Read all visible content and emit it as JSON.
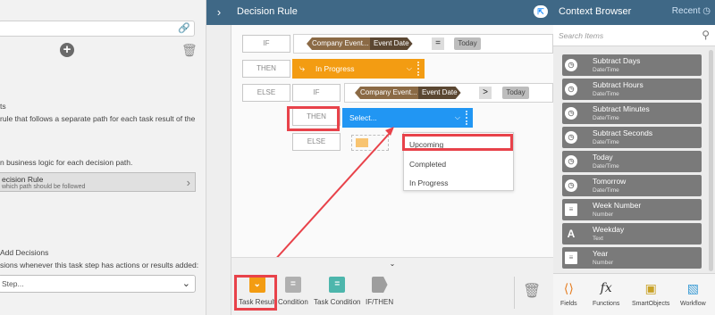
{
  "left_panel": {
    "line_ts": "ts",
    "line_rule": "rule that follows a separate path for each task result of the",
    "line_logic": "n business logic for each decision path.",
    "selected_title": "ecision Rule",
    "selected_sub": "which path should be followed",
    "add_decisions": "Add Decisions",
    "actions_text": "sions whenever this task step has actions or results added:",
    "select_placeholder": "Step..."
  },
  "decision_rule": {
    "title": "Decision Rule",
    "if_label": "IF",
    "then_label": "THEN",
    "else_label": "ELSE",
    "company_event": "Company Event...",
    "event_date": "Event Date",
    "operator_eq": "=",
    "operator_gt": ">",
    "today": "Today",
    "in_progress": "In Progress",
    "select_placeholder": "Select...",
    "dropdown_options": [
      "Upcoming",
      "Completed",
      "In Progress"
    ]
  },
  "toolbox": {
    "items": [
      "Task Result",
      "Condition",
      "Task Condition",
      "IF/THEN"
    ]
  },
  "context_browser": {
    "title": "Context Browser",
    "recent": "Recent",
    "search_placeholder": "Search Items",
    "items": [
      {
        "name": "Subtract Days",
        "type": "Date/Time",
        "icon": "clock"
      },
      {
        "name": "Subtract Hours",
        "type": "Date/Time",
        "icon": "clock"
      },
      {
        "name": "Subtract Minutes",
        "type": "Date/Time",
        "icon": "clock"
      },
      {
        "name": "Subtract Seconds",
        "type": "Date/Time",
        "icon": "clock"
      },
      {
        "name": "Today",
        "type": "Date/Time",
        "icon": "clock"
      },
      {
        "name": "Tomorrow",
        "type": "Date/Time",
        "icon": "clock"
      },
      {
        "name": "Week Number",
        "type": "Number",
        "icon": "list"
      },
      {
        "name": "Weekday",
        "type": "Text",
        "icon": "text"
      },
      {
        "name": "Year",
        "type": "Number",
        "icon": "list"
      }
    ],
    "tabs": [
      "Fields",
      "Functions",
      "SmartObjects",
      "Workflow"
    ]
  },
  "colors": {
    "header": "#3f6886",
    "orange": "#f39c12",
    "blue": "#2196f3",
    "highlight": "#e8424a"
  }
}
